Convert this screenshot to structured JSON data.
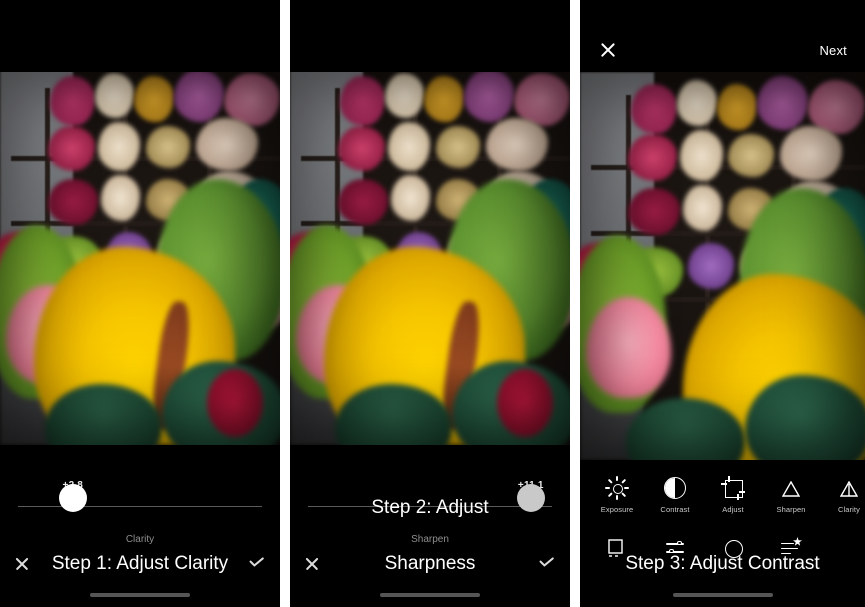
{
  "panels": [
    {
      "id": "panel-step-1",
      "caption": "Step 1: Adjust Clarity",
      "slider": {
        "value_label": "+2.8",
        "tool_name": "Clarity",
        "knob_pct": 26
      },
      "actions": {
        "cancel_icon": "close-icon",
        "confirm_icon": "check-icon"
      }
    },
    {
      "id": "panel-step-2",
      "caption_line1": "Step 2: Adjust",
      "caption_line2": "Sharpness",
      "slider": {
        "value_label": "+11.1",
        "tool_name": "Sharpen",
        "knob_pct": 86
      },
      "actions": {
        "cancel_icon": "close-icon",
        "confirm_icon": "check-icon"
      }
    },
    {
      "id": "panel-step-3",
      "caption": "Step 3: Adjust Contrast",
      "topbar": {
        "close_icon": "close-icon",
        "next_label": "Next"
      },
      "toolbar_row1": [
        {
          "label": "Exposure",
          "icon": "exposure-icon"
        },
        {
          "label": "Contrast",
          "icon": "contrast-icon"
        },
        {
          "label": "Adjust",
          "icon": "adjust-crop-icon"
        },
        {
          "label": "Sharpen",
          "icon": "sharpen-triangle-icon"
        },
        {
          "label": "Clarity",
          "icon": "clarity-triangle-icon"
        }
      ],
      "toolbar_row2": [
        {
          "label": "",
          "icon": "frame-icon"
        },
        {
          "label": "",
          "icon": "sliders-icon"
        },
        {
          "label": "",
          "icon": "circle-icon"
        },
        {
          "label": "",
          "icon": "effects-icon"
        }
      ]
    }
  ],
  "colors": {
    "background": "#000000",
    "text": "#ffffff",
    "muted_text": "#8e8e8e",
    "track": "#5a5a5a",
    "knob_active": "#ffffff",
    "knob_inactive": "#c9c9c9",
    "home_indicator": "#555555"
  },
  "photo": {
    "subject": "flower-market-stall",
    "description": "blurred photo of a flower market with shelves of cut flowers and yellow plumes in foreground"
  }
}
